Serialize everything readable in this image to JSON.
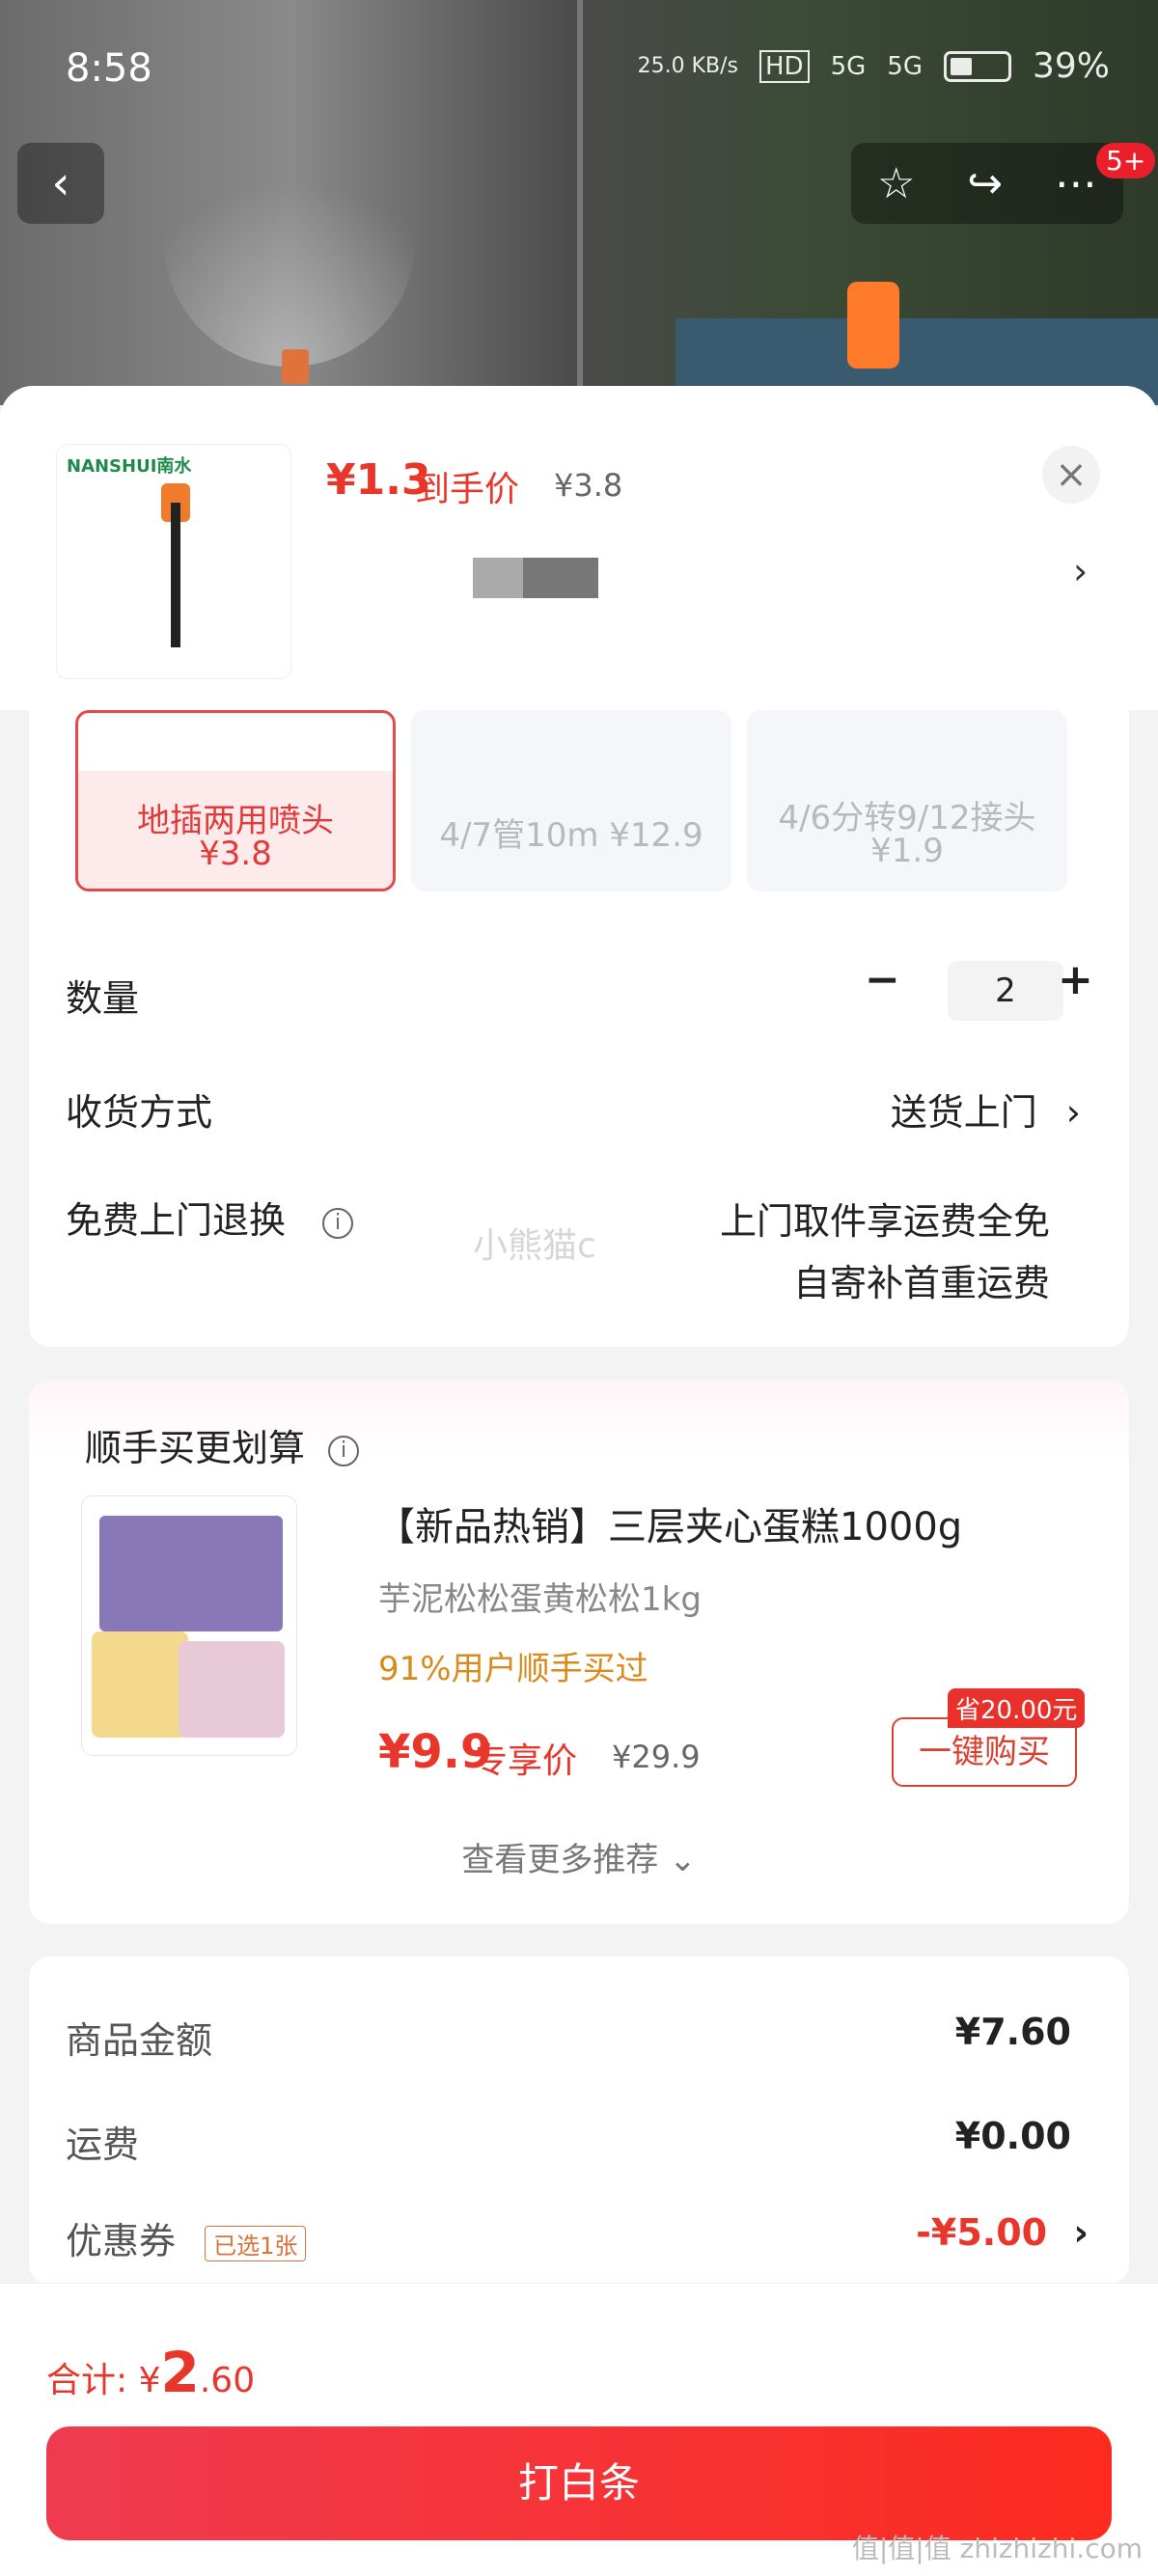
{
  "status_bar": {
    "time": "8:58",
    "net_speed": "25.0 KB/s",
    "hd": "HD",
    "signal1": "5G",
    "signal2": "5G",
    "battery": "39%"
  },
  "top_nav": {
    "back_icon": "chevron-left-icon",
    "favorite_icon": "star-icon",
    "share_icon": "share-icon",
    "more_icon": "more-icon",
    "badge": "5+"
  },
  "product": {
    "brand": "NANSHUI南水",
    "price": "¥1.3",
    "price_label": "到手价",
    "original_price": "¥3.8"
  },
  "variants": [
    {
      "name": "地插两用喷头",
      "price": "¥3.8",
      "selected": true
    },
    {
      "name": "4/7管10m ¥12.9",
      "price": "",
      "selected": false
    },
    {
      "name": "4/6分转9/12接头",
      "price": "¥1.9",
      "selected": false
    }
  ],
  "options": {
    "quantity_label": "数量",
    "quantity_value": "2",
    "delivery_label": "收货方式",
    "delivery_value": "送货上门",
    "return_label": "免费上门退换",
    "return_line1": "上门取件享运费全免",
    "return_line2": "自寄补首重运费"
  },
  "watermark": "小熊猫c",
  "recommendation": {
    "title": "顺手买更划算",
    "name": "【新品热销】三层夹心蛋糕1000g",
    "sub": "芋泥松松蛋黄松松1kg",
    "bought": "91%用户顺手买过",
    "price": "¥9.9",
    "price_label": "专享价",
    "original_price": "¥29.9",
    "save_tag": "省20.00元",
    "buy_label": "一键购买",
    "more_label": "查看更多推荐"
  },
  "summary": {
    "goods_label": "商品金额",
    "goods_value": "¥7.60",
    "shipping_label": "运费",
    "shipping_value": "¥0.00",
    "coupon_label": "优惠券",
    "coupon_tag": "已选1张",
    "coupon_value": "-¥5.00"
  },
  "footer": {
    "total_label": "合计:",
    "total_currency": "¥",
    "total_int": "2",
    "total_dec": ".60",
    "pay_label": "打白条",
    "corner_watermark": "值|值|值 zhizhizhi.com"
  }
}
